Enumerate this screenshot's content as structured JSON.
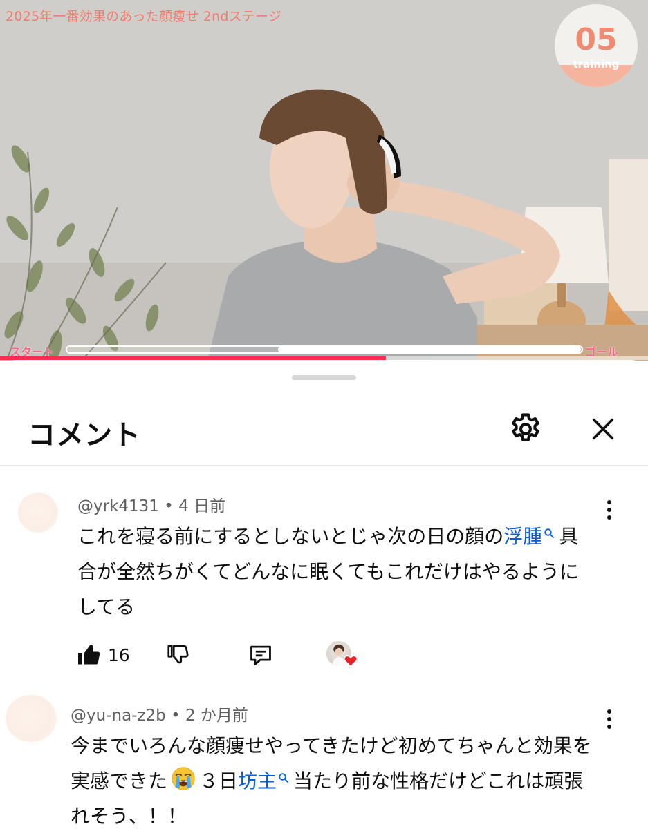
{
  "video": {
    "title": "2025年一番効果のあった顔痩せ 2ndステージ",
    "badge_number": "05",
    "badge_label": "training",
    "progress_start_label": "スタート",
    "progress_goal_label": "ゴール",
    "training_progress_fraction": 0.59,
    "playback_played_fraction": 0.595,
    "playback_buffered_fraction": 0.66,
    "accent_color": "#ef6b8a",
    "playback_color": "#ff2c4d"
  },
  "sheet": {
    "title": "コメント",
    "settings_icon": "gear-icon",
    "close_icon": "close-icon"
  },
  "comments": [
    {
      "author": "@yrk4131",
      "time": "4 日前",
      "text_part1": "これを寝る前にするとしないとじゃ次の日の顔の",
      "link_text": "浮腫",
      "text_part2": "具合が全然ちがくてどんなに眠くてもこれだけはやるようにしてる",
      "likes": "16",
      "creator_hearted": true
    },
    {
      "author": "@yu-na-z2b",
      "time": "2 か月前",
      "text_part1": "今までいろんな顔痩せやってきたけど初めてちゃんと効果を実感できた",
      "emoji": "loudly-crying-face",
      "text_part2": "３日",
      "link_text": "坊主",
      "text_part3": "当たり前な性格だけどこれは頑張れそう、！！"
    }
  ],
  "colors": {
    "link": "#065fd4",
    "meta": "#606060",
    "heart": "#e8232c"
  }
}
